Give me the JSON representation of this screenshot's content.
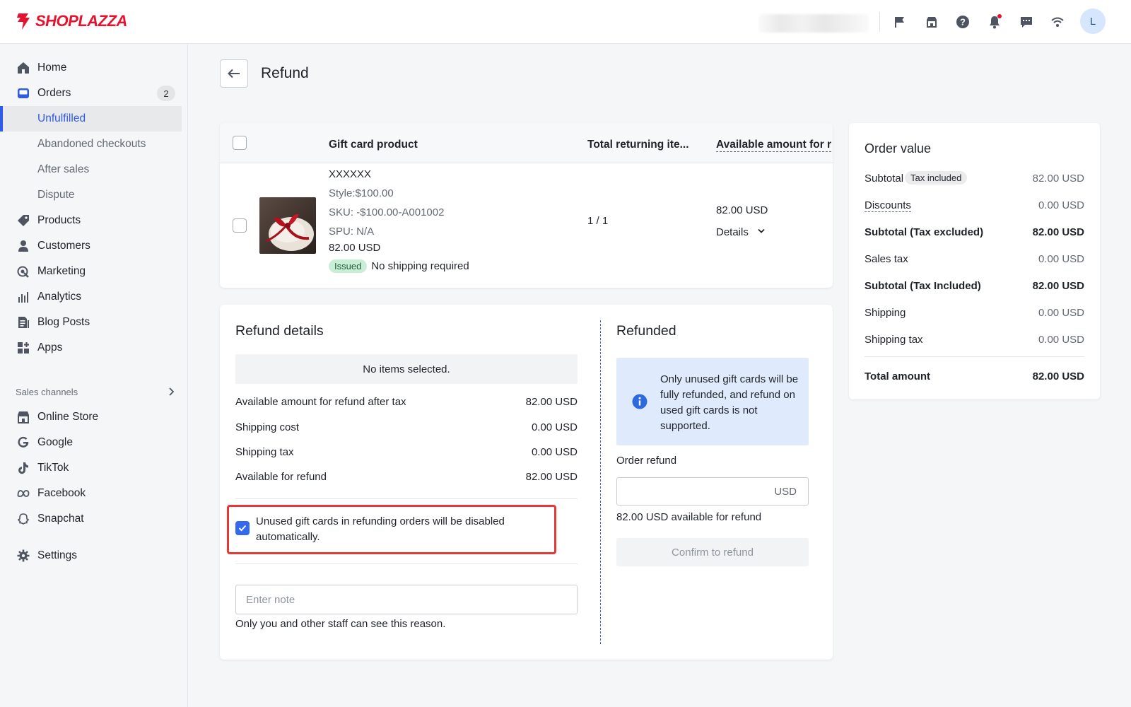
{
  "brand": {
    "name": "SHOPLAZZA",
    "color": "#e8112d"
  },
  "topbar": {
    "icons": [
      "flag-icon",
      "store-icon",
      "help-icon",
      "bell-icon",
      "chat-icon",
      "wifi-icon"
    ],
    "avatar_initial": "L"
  },
  "sidebar": {
    "items": [
      {
        "label": "Home",
        "icon": "home-icon"
      },
      {
        "label": "Orders",
        "icon": "orders-icon",
        "badge": "2"
      },
      {
        "label": "Unfulfilled",
        "active": true
      },
      {
        "label": "Abandoned checkouts"
      },
      {
        "label": "After sales"
      },
      {
        "label": "Dispute"
      },
      {
        "label": "Products",
        "icon": "tag-icon"
      },
      {
        "label": "Customers",
        "icon": "person-icon"
      },
      {
        "label": "Marketing",
        "icon": "marketing-icon"
      },
      {
        "label": "Analytics",
        "icon": "bar-chart-icon"
      },
      {
        "label": "Blog Posts",
        "icon": "blog-icon"
      },
      {
        "label": "Apps",
        "icon": "apps-icon"
      }
    ],
    "sales_channels_label": "Sales channels",
    "channels": [
      {
        "label": "Online Store",
        "icon": "store-icon"
      },
      {
        "label": "Google",
        "icon": "google-icon"
      },
      {
        "label": "TikTok",
        "icon": "tiktok-icon"
      },
      {
        "label": "Facebook",
        "icon": "meta-icon"
      },
      {
        "label": "Snapchat",
        "icon": "snapchat-icon"
      }
    ],
    "settings_label": "Settings"
  },
  "page": {
    "title": "Refund"
  },
  "products_table": {
    "headers": {
      "product": "Gift card product",
      "returning": "Total returning ite...",
      "available": "Available amount for r"
    },
    "row": {
      "name": "XXXXXX",
      "style": "Style:$100.00",
      "sku": "SKU: -$100.00-A001002",
      "spu": "SPU: N/A",
      "price": "82.00 USD",
      "status_tag": "Issued",
      "shipping_note": "No shipping required",
      "returning": "1 / 1",
      "available_amount": "82.00 USD",
      "details_label": "Details"
    }
  },
  "refund_details": {
    "title": "Refund details",
    "empty_message": "No items selected.",
    "rows": [
      {
        "label": "Available amount for refund after tax",
        "value": "82.00 USD"
      },
      {
        "label": "Shipping cost",
        "value": "0.00 USD"
      },
      {
        "label": "Shipping tax",
        "value": "0.00 USD"
      },
      {
        "label": "Available for refund",
        "value": "82.00 USD"
      }
    ],
    "disable_gift_cards_checkbox": {
      "checked": true,
      "label_line1": "Unused gift cards in refunding orders will be disabled",
      "label_line2": "automatically."
    },
    "note_placeholder": "Enter note",
    "note_hint": "Only you and other staff can see this reason."
  },
  "refunded": {
    "title": "Refunded",
    "info": "Only unused gift cards will be fully refunded, and refund on used gift cards is not supported.",
    "order_refund_label": "Order refund",
    "currency": "USD",
    "available_hint": "82.00 USD available for refund",
    "confirm_label": "Confirm to refund"
  },
  "order_value": {
    "title": "Order value",
    "subtotal_label": "Subtotal",
    "tax_included_pill": "Tax included",
    "rows": [
      {
        "label": "Subtotal",
        "value": "82.00 USD",
        "bold": false
      },
      {
        "label": "Discounts",
        "value": "0.00 USD",
        "bold": false
      },
      {
        "label": "Subtotal (Tax excluded)",
        "value": "82.00 USD",
        "bold": true
      },
      {
        "label": "Sales tax",
        "value": "0.00 USD",
        "bold": false
      },
      {
        "label": "Subtotal (Tax Included)",
        "value": "82.00 USD",
        "bold": true
      },
      {
        "label": "Shipping",
        "value": "0.00 USD",
        "bold": false
      },
      {
        "label": "Shipping tax",
        "value": "0.00 USD",
        "bold": false
      }
    ],
    "total": {
      "label": "Total amount",
      "value": "82.00 USD"
    }
  }
}
